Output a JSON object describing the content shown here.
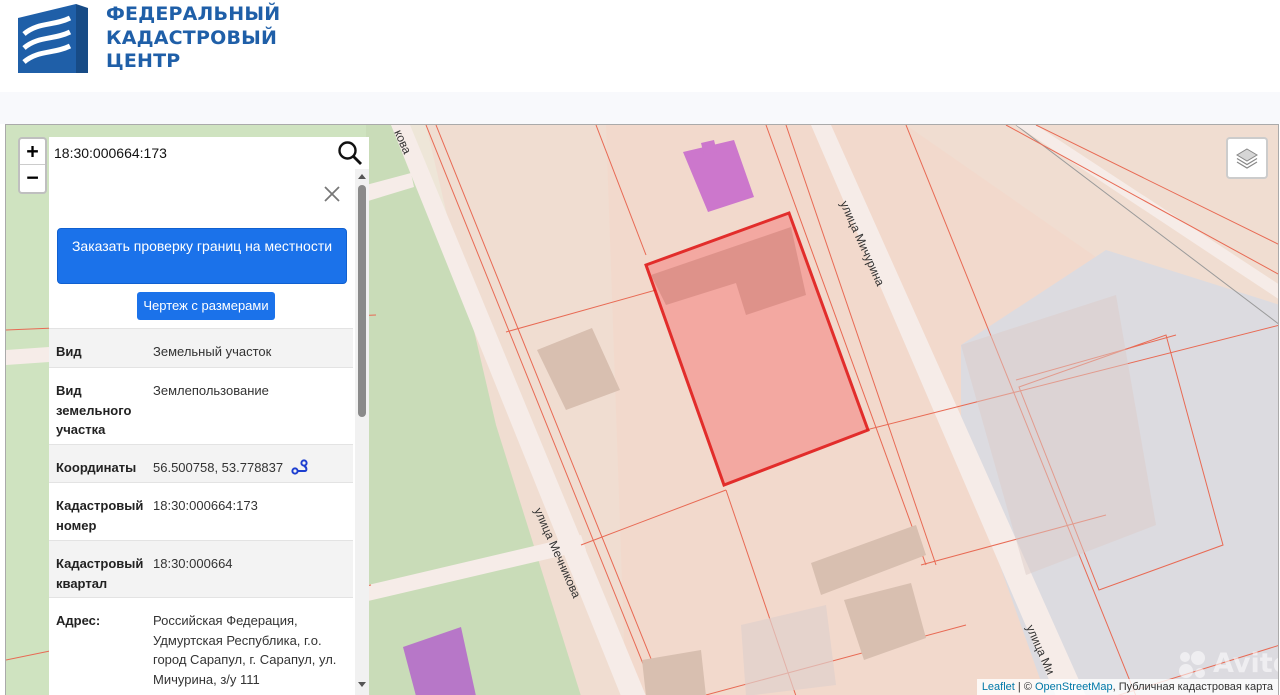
{
  "header": {
    "logo_lines": [
      "ФЕДЕРАЛЬНЫЙ",
      "КАДАСТРОВЫЙ",
      "ЦЕНТР"
    ],
    "brand_color": "#1f5fa8"
  },
  "map": {
    "zoom_in": "+",
    "zoom_out": "−",
    "search_value": "18:30:000664:173",
    "street_labels": {
      "mechnikova_top": "кова",
      "michurina": "улица Мичурина",
      "mechnikova": "улица Мечникова",
      "michurina_bottom": "улица Ми"
    },
    "attribution": {
      "leaflet": "Leaflet",
      "sep": " | © ",
      "osm": "OpenStreetMap",
      "rest": ", Публичная кадастровая карта"
    },
    "watermark": "Avito"
  },
  "panel": {
    "order_button": "Заказать проверку границ на местности",
    "drawing_button": "Чертеж с размерами",
    "rows": [
      {
        "key": "Вид",
        "value": "Земельный участок"
      },
      {
        "key": "Вид земельного участка",
        "value": "Землепользование"
      },
      {
        "key": "Координаты",
        "value": "56.500758, 53.778837"
      },
      {
        "key": "Кадастровый номер",
        "value": "18:30:000664:173"
      },
      {
        "key": "Кадастровый квартал",
        "value": "18:30:000664"
      },
      {
        "key": "Адрес:",
        "value": "Российская Федерация, Удмуртская Республика, г.о. город Сарапул, г. Сарапул, ул. Мичурина, з/у 111"
      }
    ]
  },
  "colors": {
    "primary_button": "#1b72ea",
    "parcel_highlight": "#e01010"
  }
}
